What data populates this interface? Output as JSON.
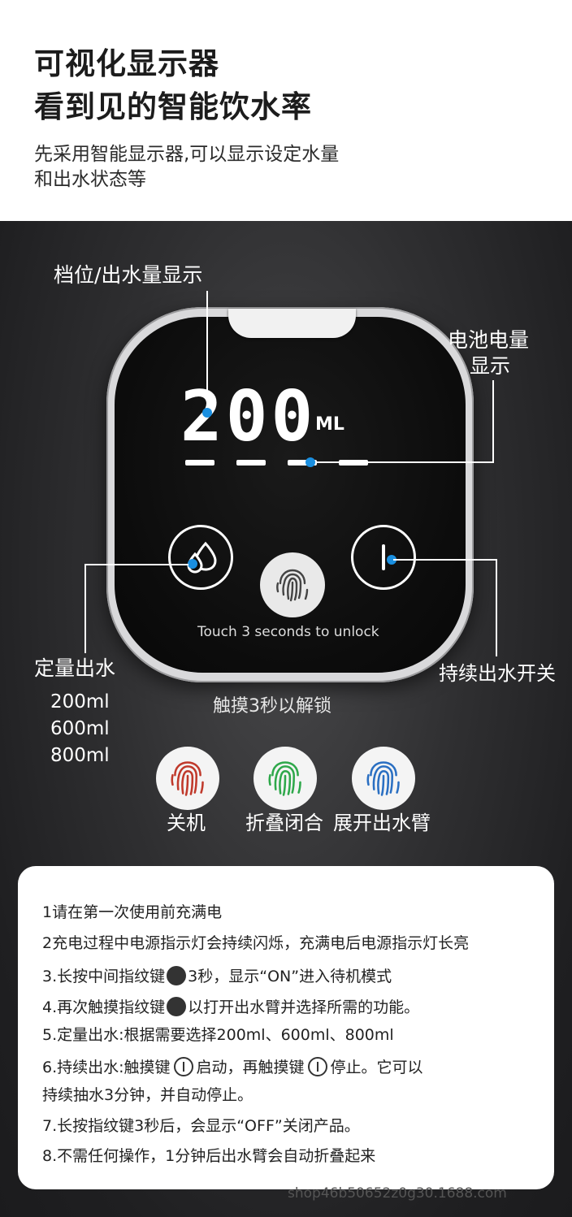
{
  "header": {
    "title_line1": "可视化显示器",
    "title_line2": "看到见的智能饮水率",
    "desc_line1": "先采用智能显示器,可以显示设定水量",
    "desc_line2": "和出水状态等"
  },
  "display": {
    "volume": "200",
    "unit": "ML",
    "unlock_hint": "Touch 3 seconds to unlock"
  },
  "annotations": {
    "gear_display": "档位/出水量显示",
    "battery_line1": "电池电量",
    "battery_line2": "显示",
    "fixed_output": "定量出水",
    "fixed_output_options": [
      "200ml",
      "600ml",
      "800ml"
    ],
    "continuous_switch": "持续出水开关",
    "touch_unlock": "触摸3秒以解锁"
  },
  "fingerprint_modes": [
    {
      "label": "关机",
      "color": "#c0392b"
    },
    {
      "label": "折叠闭合",
      "color": "#2ea84a"
    },
    {
      "label": "展开出水臂",
      "color": "#2a6fc2"
    }
  ],
  "instructions": {
    "l1": "1请在第一次使用前充满电",
    "l2": "2充电过程中电源指示灯会持续闪烁，充满电后电源指示灯长亮",
    "l3a": "3.长按中间指纹键",
    "l3b": "3秒，显示“ON”进入待机模式",
    "l4a": "4.再次触摸指纹键",
    "l4b": "以打开出水臂并选择所需的功能。",
    "l5": "5.定量出水:根据需要选择200ml、600ml、800ml",
    "l6a": "6.持续出水:触摸键",
    "l6b": "启动，再触摸键",
    "l6c": "停止。它可以",
    "l6d": "持续抽水3分钟，并自动停止。",
    "l7": "7.长按指纹键3秒后，会显示“OFF”关闭产品。",
    "l8": "8.不需任何操作，1分钟后出水臂会自动折叠起来"
  },
  "watermark": "shop46b50652z0g30.1688.com",
  "colors": {
    "accent_dot": "#1a8fe0"
  }
}
